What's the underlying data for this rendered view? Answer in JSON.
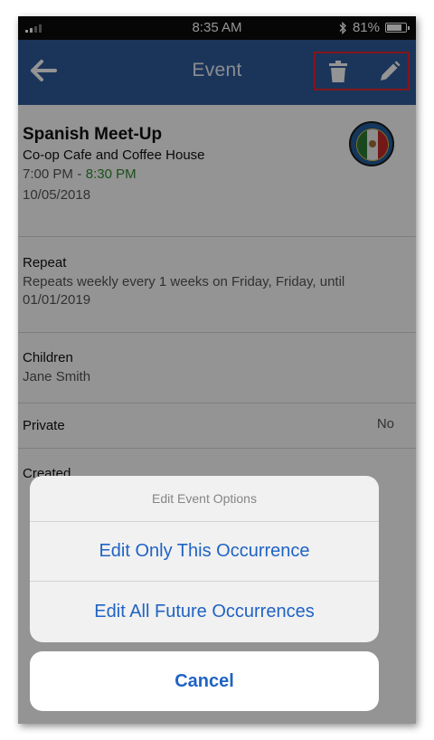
{
  "status_bar": {
    "time": "8:35 AM",
    "battery": "81%",
    "battery_level": 0.81,
    "bluetooth_icon": "bluetooth-icon"
  },
  "header": {
    "title": "Event",
    "back_icon": "arrow-left-icon",
    "delete_icon": "trash-icon",
    "edit_icon": "pencil-icon",
    "color": "#305c9c",
    "highlight_color": "#e4262f"
  },
  "event": {
    "title": "Spanish Meet-Up",
    "location": "Co-op Cafe and Coffee House",
    "start_time": "7:00 PM",
    "separator": "-",
    "end_time": "8:30 PM",
    "date": "10/05/2018",
    "badge_icon": "mexico-flag-icon"
  },
  "repeat": {
    "label": "Repeat",
    "line1": "Repeats weekly every 1 weeks on Friday, Friday,  until",
    "line2": "01/01/2019"
  },
  "children": {
    "label": "Children",
    "value": "Jane Smith"
  },
  "private": {
    "label": "Private",
    "value": "No"
  },
  "created": {
    "label": "Created"
  },
  "action_sheet": {
    "title": "Edit Event Options",
    "option1": "Edit Only This Occurrence",
    "option2": "Edit All Future Occurrences",
    "cancel": "Cancel",
    "accent_color": "#1f63c4"
  }
}
